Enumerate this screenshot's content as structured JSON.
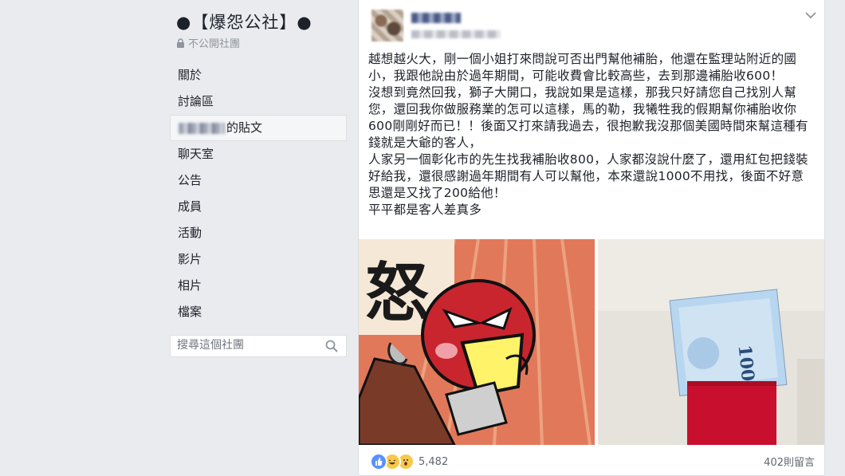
{
  "group": {
    "title": "●【爆怨公社】●",
    "privacy": "不公開社團"
  },
  "nav": {
    "about": "關於",
    "discussion": "討論區",
    "posts_suffix": "的貼文",
    "chats": "聊天室",
    "announcements": "公告",
    "members": "成員",
    "events": "活動",
    "videos": "影片",
    "photos": "相片",
    "files": "檔案"
  },
  "search": {
    "placeholder": "搜尋這個社團"
  },
  "post": {
    "paragraphs": [
      "越想越火大，剛一個小姐打來問說可否出門幫他補胎，他還在監理站附近的國小，我跟他說由於過年期間，可能收費會比較高些，去到那邊補胎收600！",
      "沒想到竟然回我，獅子大開口，我說如果是這樣，那我只好請您自己找別人幫您，還回我你做服務業的怎可以這樣，馬的勒，我犧牲我的假期幫你補胎收你600剛剛好而已！！後面又打來請我過去，很抱歉我沒那個美國時間來幫這種有錢就是大爺的客人，",
      "人家另一個彰化市的先生找我補胎收800，人家都沒說什麼了，還用紅包把錢裝好給我，還很感謝過年期間有人可以幫他，本來還說1000不用找，後面不好意思還是又找了200給他！",
      "平平都是客人差真多"
    ],
    "photo1_text": "怒",
    "photo2_text": "1000",
    "reaction_count": "5,482",
    "comment_count": "402則留言"
  },
  "colors": {
    "background": "#e9ebee",
    "card": "#ffffff",
    "like_blue": "#5890ff",
    "red_envelope": "#c8102e"
  },
  "icons": [
    "lock-icon",
    "search-icon",
    "chevron-down-icon",
    "like-icon",
    "haha-icon",
    "wow-icon"
  ]
}
